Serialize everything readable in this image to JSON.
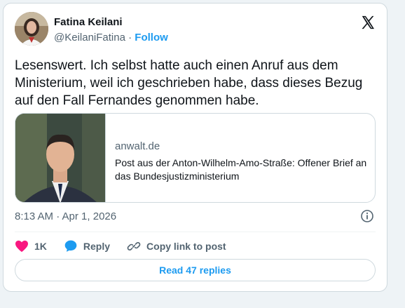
{
  "author": {
    "name": "Fatina Keilani",
    "handle": "@KeilaniFatina",
    "separator": "·",
    "follow_label": "Follow"
  },
  "tweet": {
    "text": "Lesenswert. Ich selbst hatte auch einen Anruf aus dem Ministerium, weil ich geschrieben habe, dass dieses Bezug auf den Fall Fernandes genommen habe."
  },
  "link_card": {
    "domain": "anwalt.de",
    "title": "Post aus der Anton-Wilhelm-Amo-Straße: Offener Brief an das Bundesjustizministerium"
  },
  "meta": {
    "timestamp": "8:13 AM · Apr 1, 2026"
  },
  "actions": {
    "like_count": "1K",
    "reply_label": "Reply",
    "copy_link_label": "Copy link to post"
  },
  "read_replies_label": "Read 47 replies",
  "icons": {
    "brand": "x-logo-icon",
    "like": "heart-icon",
    "reply": "speech-bubble-icon",
    "copy": "link-icon",
    "info": "info-icon"
  },
  "colors": {
    "accent": "#1d9bf0",
    "like": "#f91880",
    "muted": "#536471",
    "text": "#0f1419"
  }
}
